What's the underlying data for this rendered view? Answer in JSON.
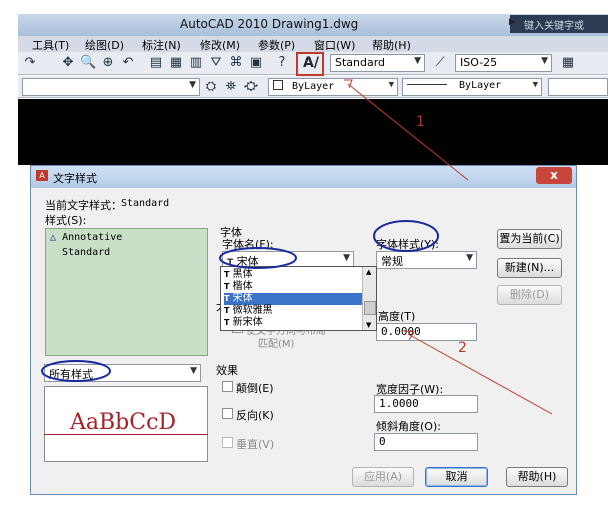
{
  "app": {
    "title": "AutoCAD 2010    Drawing1.dwg",
    "search_placeholder": "键入关键字或"
  },
  "menu": [
    "工具(T)",
    "绘图(D)",
    "标注(N)",
    "修改(M)",
    "参数(P)",
    "窗口(W)",
    "帮助(H)"
  ],
  "toolbar": {
    "text_style_value": "Standard",
    "dim_style_value": "ISO-25",
    "layer_value": "ByLayer",
    "linetype_value": "ByLayer"
  },
  "dialog": {
    "title": "文字样式",
    "current_style_label": "当前文字样式：",
    "current_style_value": "Standard",
    "styles_label": "样式(S):",
    "styles": [
      "Annotative",
      "Standard"
    ],
    "filter_value": "所有样式",
    "preview_text": "AaBbCcD",
    "font_group_label": "字体",
    "font_name_label": "字体名(F):",
    "font_name_value": "宋体",
    "font_style_label": "字体样式(Y):",
    "font_style_value": "常规",
    "font_list": [
      "黑体",
      "楷体",
      "宋体",
      "微软雅黑",
      "新宋体"
    ],
    "font_list_selected": 2,
    "size_group_label": "大",
    "match_orientation_label": "使文字方向与布局",
    "match_orientation_label2": "匹配(M)",
    "height_label": "高度(T)",
    "height_value": "0.0000",
    "effects_label": "效果",
    "upside_down_label": "颠倒(E)",
    "backwards_label": "反向(K)",
    "vertical_label": "垂直(V)",
    "width_factor_label": "宽度因子(W):",
    "width_factor_value": "1.0000",
    "oblique_label": "倾斜角度(O):",
    "oblique_value": "0",
    "set_current_button": "置为当前(C)",
    "new_button": "新建(N)...",
    "delete_button": "删除(D)",
    "apply_button": "应用(A)",
    "cancel_button": "取消",
    "help_button": "帮助(H)",
    "close_glyph": "x"
  },
  "annotations": {
    "label_1": "1",
    "label_2": "2"
  },
  "colors": {
    "annotation_red": "#c0392b",
    "annotation_blue": "#1a2a9c",
    "selection_blue": "#3a74c8"
  }
}
